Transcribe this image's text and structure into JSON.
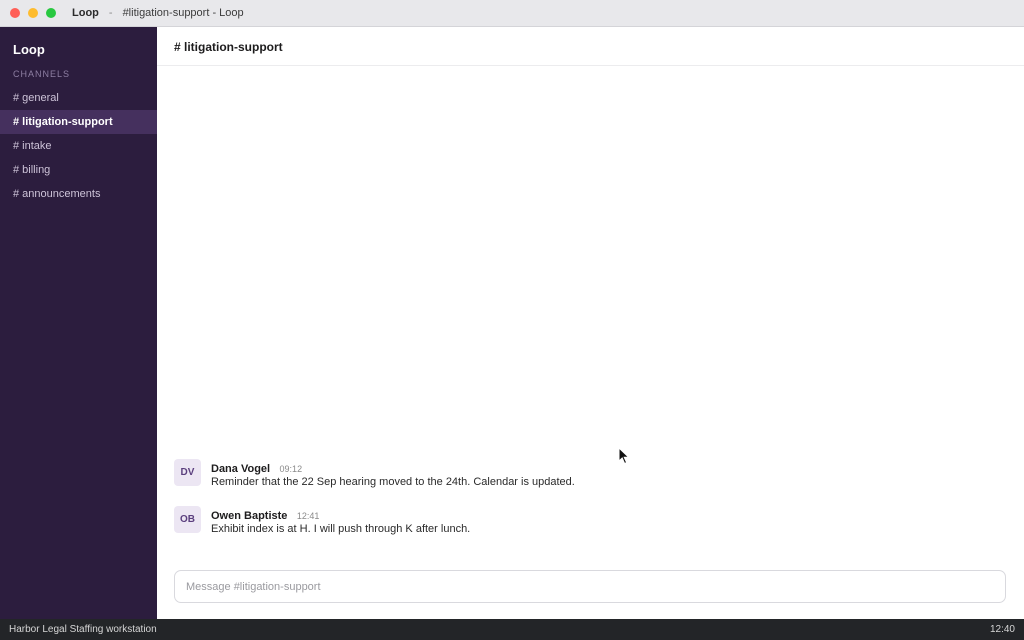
{
  "window": {
    "app_name": "Loop",
    "separator": "-",
    "title": "#litigation-support - Loop"
  },
  "sidebar": {
    "workspace": "Loop",
    "section_label": "CHANNELS",
    "channels": [
      {
        "label": "# general",
        "active": false
      },
      {
        "label": "# litigation-support",
        "active": true
      },
      {
        "label": "# intake",
        "active": false
      },
      {
        "label": "# billing",
        "active": false
      },
      {
        "label": "# announcements",
        "active": false
      }
    ]
  },
  "main": {
    "channel_title": "# litigation-support",
    "messages": [
      {
        "initials": "DV",
        "author": "Dana Vogel",
        "time": "09:12",
        "text": "Reminder that the 22 Sep hearing moved to the 24th. Calendar is updated."
      },
      {
        "initials": "OB",
        "author": "Owen Baptiste",
        "time": "12:41",
        "text": "Exhibit index is at H. I will push through K after lunch."
      }
    ],
    "composer": {
      "value": "",
      "placeholder": "Message #litigation-support"
    }
  },
  "statusbar": {
    "left": "Harbor Legal Staffing workstation",
    "right": "12:40"
  },
  "colors": {
    "sidebar_bg": "#2c1d3e",
    "active_channel_bg": "#45305e",
    "avatar_bg": "#ece6f3",
    "status_bg": "#232528"
  },
  "icons": {
    "close": "red-circle",
    "minimize": "yellow-circle",
    "zoom": "green-circle",
    "pointer": "mouse-pointer-arrow"
  }
}
